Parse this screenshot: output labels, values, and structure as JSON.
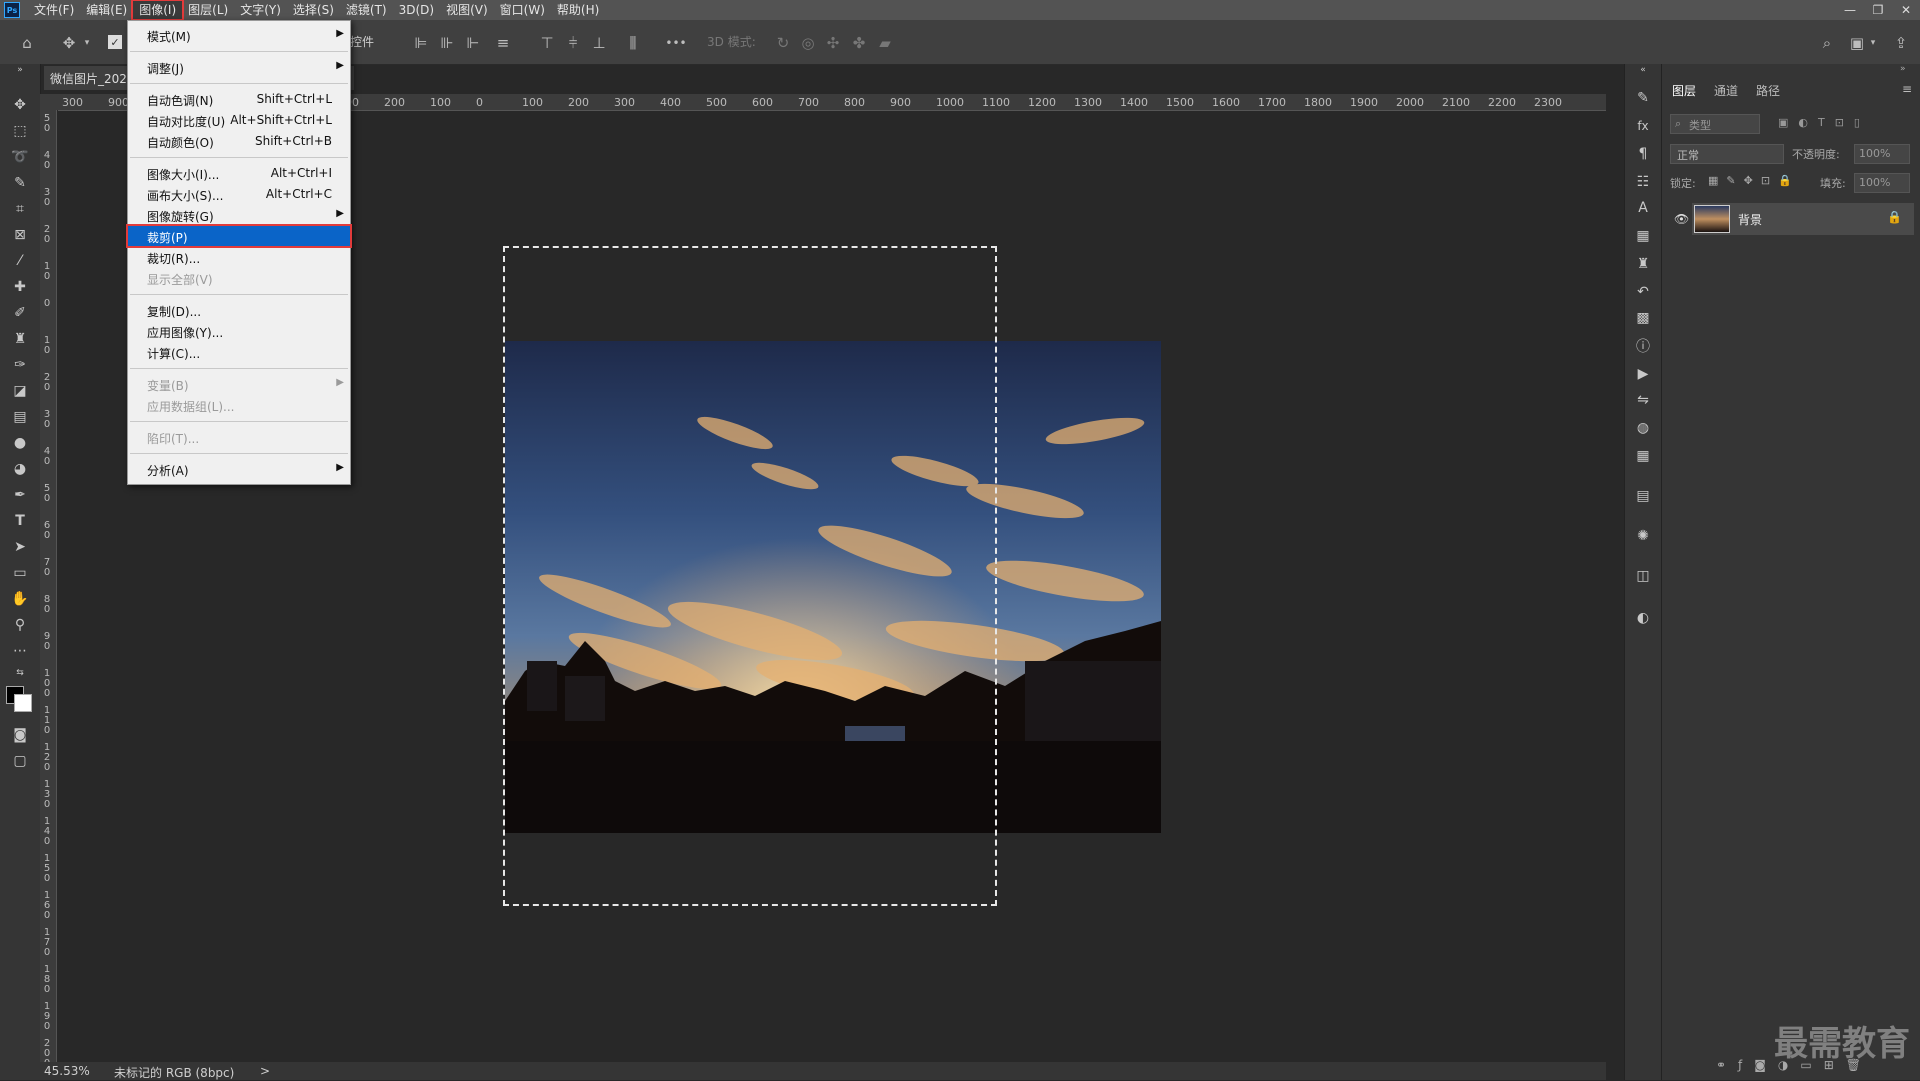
{
  "menubar": {
    "logo": "Ps",
    "items": [
      {
        "label": "文件(F)"
      },
      {
        "label": "编辑(E)"
      },
      {
        "label": "图像(I)"
      },
      {
        "label": "图层(L)"
      },
      {
        "label": "文字(Y)"
      },
      {
        "label": "选择(S)"
      },
      {
        "label": "滤镜(T)"
      },
      {
        "label": "3D(D)"
      },
      {
        "label": "视图(V)"
      },
      {
        "label": "窗口(W)"
      },
      {
        "label": "帮助(H)"
      }
    ],
    "active_index": 2
  },
  "window_controls": {
    "minimize": "—",
    "restore": "❐",
    "close": "✕"
  },
  "options_bar": {
    "controls_text": "控件",
    "mode_3d_label": "3D 模式:",
    "more": "•••"
  },
  "document": {
    "tab_title": "微信图片_202",
    "close": "×",
    "zoom": "45.53%",
    "color_info": "未标记的 RGB (8bpc)",
    "status_arrow": ">"
  },
  "rulers": {
    "h_ticks": [
      "300",
      "900",
      "",
      "",
      "",
      "",
      "300",
      "200",
      "100",
      "0",
      "100",
      "200",
      "300",
      "400",
      "500",
      "600",
      "700",
      "800",
      "900",
      "1000",
      "1100",
      "1200",
      "1300",
      "1400",
      "1500",
      "1600",
      "1700",
      "1800",
      "1900",
      "2000",
      "2100",
      "2200",
      "2300"
    ],
    "v_ticks": [
      "50",
      "40",
      "30",
      "20",
      "10",
      "0",
      "10",
      "20",
      "30",
      "40",
      "50",
      "60",
      "70",
      "80",
      "90",
      "100",
      "110",
      "120",
      "130",
      "140",
      "150",
      "160",
      "170",
      "180",
      "190",
      "200"
    ]
  },
  "image_menu": {
    "items": [
      {
        "label": "模式(M)",
        "shortcut": "",
        "submenu": true,
        "disabled": false
      },
      {
        "sep": true
      },
      {
        "label": "调整(J)",
        "shortcut": "",
        "submenu": true,
        "disabled": false
      },
      {
        "sep": true
      },
      {
        "label": "自动色调(N)",
        "shortcut": "Shift+Ctrl+L",
        "submenu": false,
        "disabled": false
      },
      {
        "label": "自动对比度(U)",
        "shortcut": "Alt+Shift+Ctrl+L",
        "submenu": false,
        "disabled": false
      },
      {
        "label": "自动颜色(O)",
        "shortcut": "Shift+Ctrl+B",
        "submenu": false,
        "disabled": false
      },
      {
        "sep": true
      },
      {
        "label": "图像大小(I)...",
        "shortcut": "Alt+Ctrl+I",
        "submenu": false,
        "disabled": false
      },
      {
        "label": "画布大小(S)...",
        "shortcut": "Alt+Ctrl+C",
        "submenu": false,
        "disabled": false
      },
      {
        "label": "图像旋转(G)",
        "shortcut": "",
        "submenu": true,
        "disabled": false
      },
      {
        "label": "裁剪(P)",
        "shortcut": "",
        "submenu": false,
        "disabled": false,
        "selected": true
      },
      {
        "label": "裁切(R)...",
        "shortcut": "",
        "submenu": false,
        "disabled": false
      },
      {
        "label": "显示全部(V)",
        "shortcut": "",
        "submenu": false,
        "disabled": true
      },
      {
        "sep": true
      },
      {
        "label": "复制(D)...",
        "shortcut": "",
        "submenu": false,
        "disabled": false
      },
      {
        "label": "应用图像(Y)...",
        "shortcut": "",
        "submenu": false,
        "disabled": false
      },
      {
        "label": "计算(C)...",
        "shortcut": "",
        "submenu": false,
        "disabled": false
      },
      {
        "sep": true
      },
      {
        "label": "变量(B)",
        "shortcut": "",
        "submenu": true,
        "disabled": true
      },
      {
        "label": "应用数据组(L)...",
        "shortcut": "",
        "submenu": false,
        "disabled": true
      },
      {
        "sep": true
      },
      {
        "label": "陷印(T)...",
        "shortcut": "",
        "submenu": false,
        "disabled": true
      },
      {
        "sep": true
      },
      {
        "label": "分析(A)",
        "shortcut": "",
        "submenu": true,
        "disabled": false
      }
    ]
  },
  "layers_panel": {
    "tabs": [
      "图层",
      "通道",
      "路径"
    ],
    "active_tab": 0,
    "filter_placeholder": "类型",
    "blend_mode": "正常",
    "opacity_label": "不透明度:",
    "opacity_value": "100%",
    "lock_label": "锁定:",
    "fill_label": "填充:",
    "fill_value": "100%",
    "layers": [
      {
        "name": "背景",
        "visible": true,
        "locked": true
      }
    ],
    "footer_icons": [
      "link-icon",
      "fx-icon",
      "mask-icon",
      "adjustment-icon",
      "folder-icon",
      "new-layer-icon",
      "trash-icon"
    ]
  },
  "watermark": "最需教育",
  "colors": {
    "menu_highlight": "#0a64c8",
    "annotation_red": "#e23b3b",
    "ui_dark": "#282828",
    "ui_panel": "#353535"
  }
}
